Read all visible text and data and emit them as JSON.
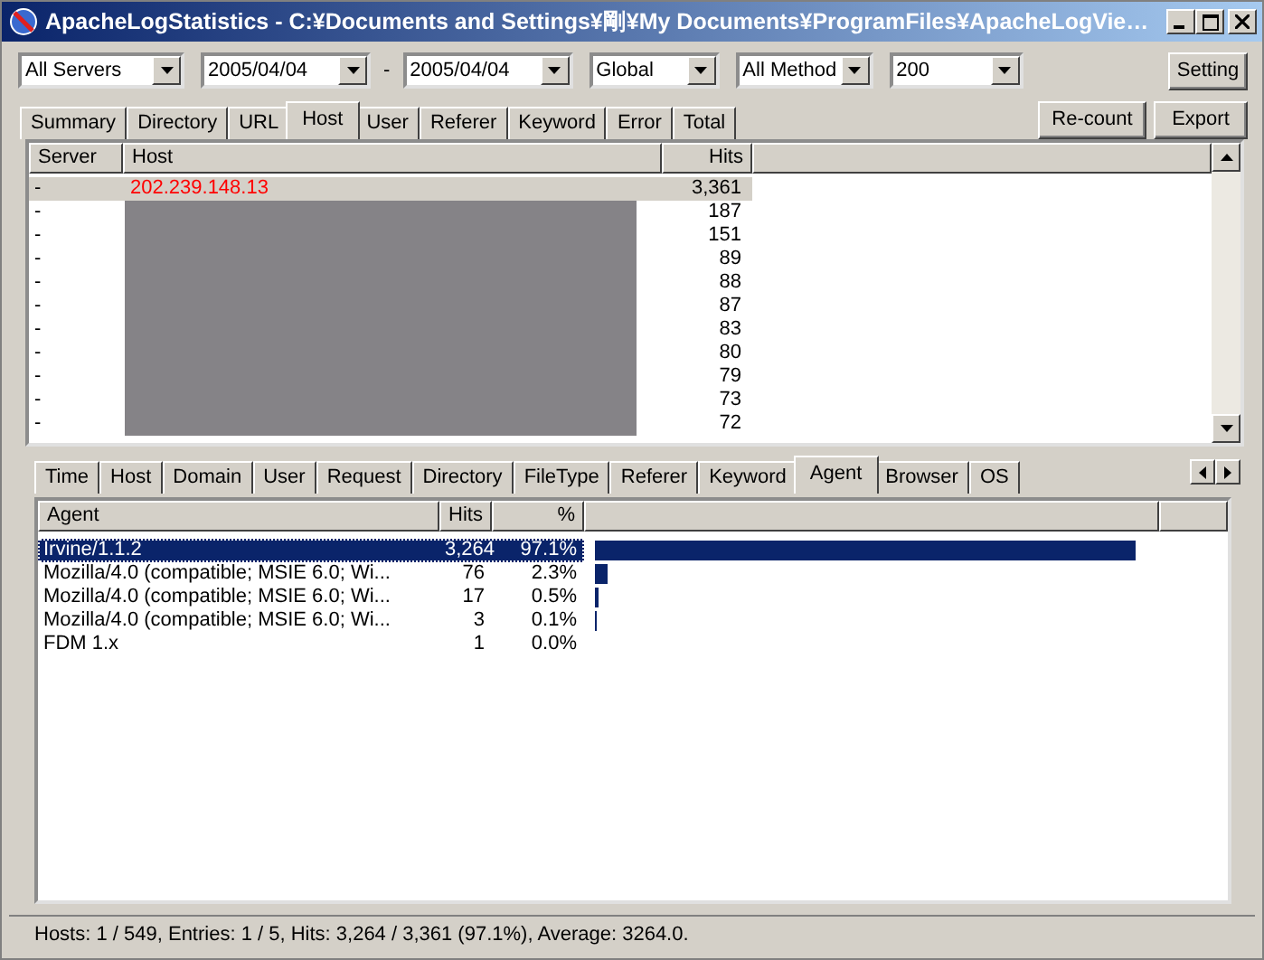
{
  "window": {
    "title": "ApacheLogStatistics - C:¥Documents and Settings¥剛¥My Documents¥ProgramFiles¥ApacheLogVie…"
  },
  "filters": [
    {
      "kind": "combo",
      "value": "All Servers"
    },
    {
      "kind": "combo",
      "value": "2005/04/04"
    },
    {
      "kind": "label",
      "value": "-"
    },
    {
      "kind": "combo",
      "value": "2005/04/04"
    },
    {
      "kind": "combo",
      "value": "Global"
    },
    {
      "kind": "combo",
      "value": "All Method"
    },
    {
      "kind": "combo",
      "value": "200"
    }
  ],
  "buttons": {
    "setting": "Setting",
    "recount": "Re-count",
    "export": "Export"
  },
  "top_tabs": [
    {
      "label": "Summary",
      "selected": false
    },
    {
      "label": "Directory",
      "selected": false
    },
    {
      "label": "URL",
      "selected": false
    },
    {
      "label": "Host",
      "selected": true
    },
    {
      "label": "User",
      "selected": false
    },
    {
      "label": "Referer",
      "selected": false
    },
    {
      "label": "Keyword",
      "selected": false
    },
    {
      "label": "Error",
      "selected": false
    },
    {
      "label": "Total",
      "selected": false
    }
  ],
  "host_table": {
    "columns": [
      "Server",
      "Host",
      "Hits"
    ],
    "rows": [
      {
        "server": "-",
        "host": "202.239.148.13",
        "hits": "3,361",
        "selected": true
      },
      {
        "server": "-",
        "hits": "187",
        "selected": false
      },
      {
        "server": "-",
        "hits": "151",
        "selected": false
      },
      {
        "server": "-",
        "hits": "89",
        "selected": false
      },
      {
        "server": "-",
        "hits": "88",
        "selected": false
      },
      {
        "server": "-",
        "hits": "87",
        "selected": false
      },
      {
        "server": "-",
        "hits": "83",
        "selected": false
      },
      {
        "server": "-",
        "hits": "80",
        "selected": false
      },
      {
        "server": "-",
        "hits": "79",
        "selected": false
      },
      {
        "server": "-",
        "hits": "73",
        "selected": false
      },
      {
        "server": "-",
        "hits": "72",
        "selected": false
      }
    ]
  },
  "bottom_tabs": [
    {
      "label": "Time",
      "selected": false
    },
    {
      "label": "Host",
      "selected": false
    },
    {
      "label": "Domain",
      "selected": false
    },
    {
      "label": "User",
      "selected": false
    },
    {
      "label": "Request",
      "selected": false
    },
    {
      "label": "Directory",
      "selected": false
    },
    {
      "label": "FileType",
      "selected": false
    },
    {
      "label": "Referer",
      "selected": false
    },
    {
      "label": "Keyword",
      "selected": false
    },
    {
      "label": "Agent",
      "selected": true
    },
    {
      "label": "Browser",
      "selected": false
    },
    {
      "label": "OS",
      "selected": false
    }
  ],
  "agent_table": {
    "columns": [
      "Agent",
      "Hits",
      "%"
    ],
    "rows": [
      {
        "agent": "Irvine/1.1.2",
        "hits": "3,264",
        "percent": "97.1%",
        "level": 0.971,
        "selected": true
      },
      {
        "agent": "Mozilla/4.0 (compatible; MSIE 6.0; Wi...",
        "hits": "76",
        "percent": "2.3%",
        "level": 0.023,
        "selected": false
      },
      {
        "agent": "Mozilla/4.0 (compatible; MSIE 6.0; Wi...",
        "hits": "17",
        "percent": "0.5%",
        "level": 0.005,
        "selected": false
      },
      {
        "agent": "Mozilla/4.0 (compatible; MSIE 6.0; Wi...",
        "hits": "3",
        "percent": "0.1%",
        "level": 0.001,
        "selected": false
      },
      {
        "agent": "FDM 1.x",
        "hits": "1",
        "percent": "0.0%",
        "selected": false
      }
    ]
  },
  "status_bar": "Hosts: 1 / 549,  Entries: 1 / 5,  Hits: 3,264 / 3,361 (97.1%),  Average: 3264.0."
}
